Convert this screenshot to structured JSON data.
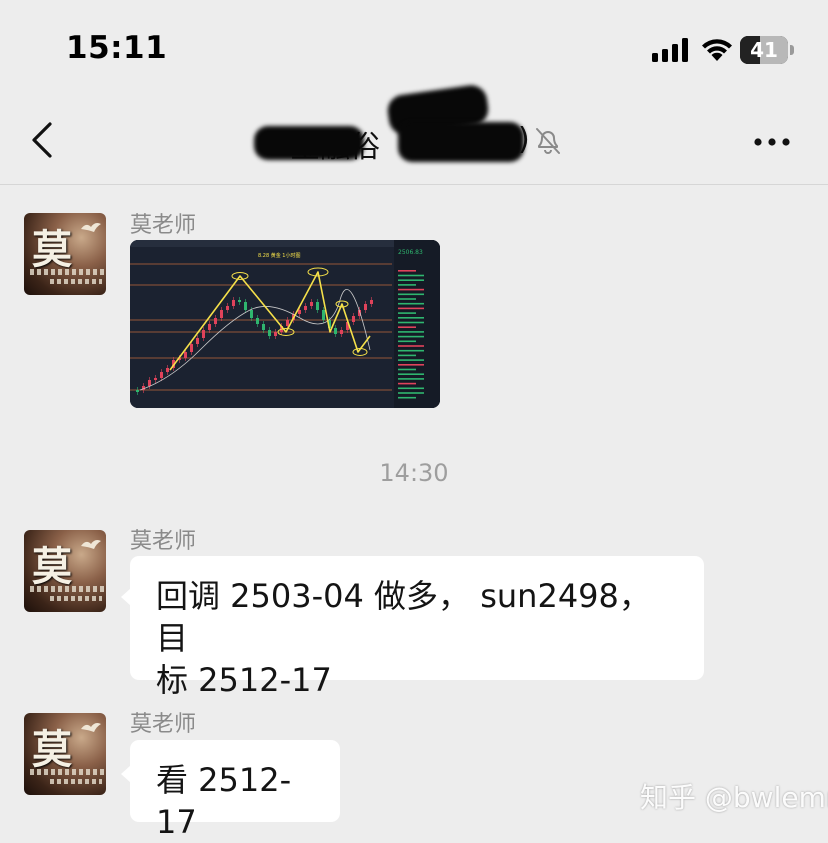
{
  "status_bar": {
    "time": "15:11",
    "battery_level": "41",
    "battery_fraction": 0.41
  },
  "nav": {
    "title": "金融俗",
    "title_suffix": ")",
    "icons": {
      "back": "chevron-left-icon",
      "mute": "bell-slash-icon",
      "more": "ellipsis-icon"
    }
  },
  "messages": [
    {
      "sender": "莫老师",
      "type": "image",
      "image_caption": "8.28 黄金 1小时图",
      "image_price": "2506.83"
    },
    {
      "type": "timestamp",
      "text": "14:30"
    },
    {
      "sender": "莫老师",
      "type": "text",
      "line1": "回调 2503-04 做多， sun2498，目",
      "line2": "标 2512-17"
    },
    {
      "sender": "莫老师",
      "type": "text",
      "line1": "看 2512-17"
    }
  ],
  "avatar": {
    "glyph": "莫"
  },
  "watermark": "知乎 @bwlemm",
  "colors": {
    "background": "#ededed",
    "bubble": "#ffffff",
    "chart_bg": "#1b2230",
    "chart_up": "#e0435b",
    "chart_down": "#2fb66f",
    "annotation": "#f5e04a"
  }
}
